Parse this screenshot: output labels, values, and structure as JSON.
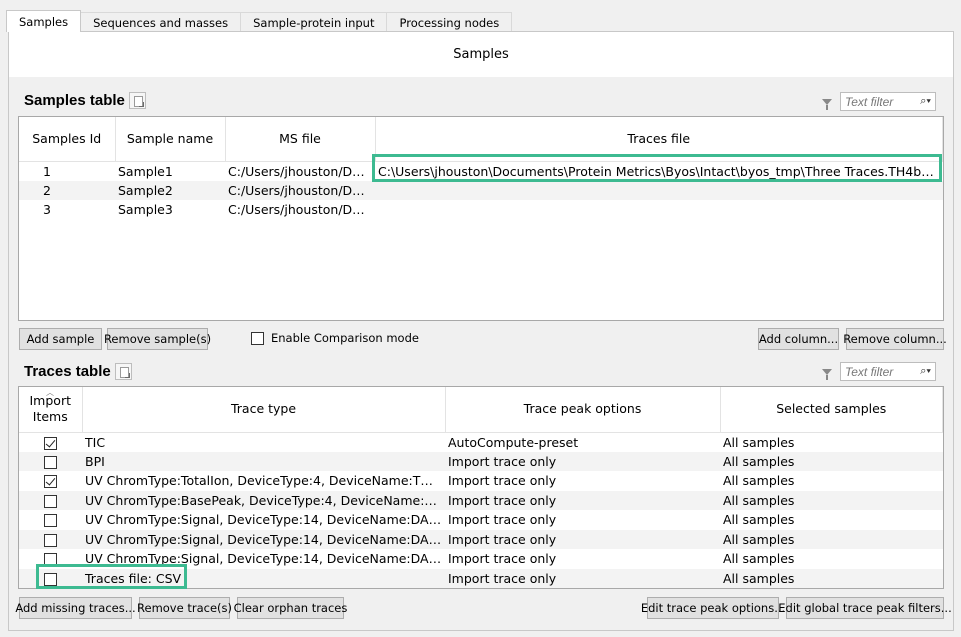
{
  "tabs": [
    "Samples",
    "Sequences and masses",
    "Sample-protein input",
    "Processing nodes"
  ],
  "header": "Samples",
  "samples_table": {
    "title": "Samples table",
    "filter_placeholder": "Text filter",
    "columns": [
      "Samples Id",
      "Sample name",
      "MS file",
      "Traces file"
    ],
    "rows": [
      [
        "1",
        "Sample1",
        "C:/Users/jhouston/Doc...",
        "C:\\Users\\jhouston\\Documents\\Protein Metrics\\Byos\\Intact\\byos_tmp\\Three Traces.TH4bW\\Thr..."
      ],
      [
        "2",
        "Sample2",
        "C:/Users/jhouston/Doc...",
        ""
      ],
      [
        "3",
        "Sample3",
        "C:/Users/jhouston/Doc...",
        ""
      ]
    ]
  },
  "samples_buttons": {
    "add_sample": "Add sample",
    "remove_samples": "Remove sample(s)",
    "enable_comparison": "Enable Comparison mode",
    "add_column": "Add column...",
    "remove_column": "Remove column..."
  },
  "traces_table": {
    "title": "Traces table",
    "filter_placeholder": "Text filter",
    "columns": [
      "Import Items",
      "Trace type",
      "Trace peak options",
      "Selected samples"
    ],
    "rows": [
      {
        "checked": true,
        "type": "TIC",
        "options": "AutoCompute-preset",
        "samples": "All samples"
      },
      {
        "checked": false,
        "type": "BPI",
        "options": "Import trace only",
        "samples": "All samples"
      },
      {
        "checked": true,
        "type": "UV ChromType:TotalIon, DeviceType:4, DeviceName:TOF, D...",
        "options": "Import trace only",
        "samples": "All samples"
      },
      {
        "checked": false,
        "type": "UV ChromType:BasePeak, DeviceType:4, DeviceName:TOF, ...",
        "options": "Import trace only",
        "samples": "All samples"
      },
      {
        "checked": false,
        "type": "UV ChromType:Signal, DeviceType:14, DeviceName:DAD, D...",
        "options": "Import trace only",
        "samples": "All samples"
      },
      {
        "checked": false,
        "type": "UV ChromType:Signal, DeviceType:14, DeviceName:DAD, D...",
        "options": "Import trace only",
        "samples": "All samples"
      },
      {
        "checked": false,
        "type": "UV ChromType:Signal, DeviceType:14, DeviceName:DAD, D...",
        "options": "Import trace only",
        "samples": "All samples"
      },
      {
        "checked": false,
        "type": "Traces file: CSV",
        "options": "Import trace only",
        "samples": "All samples"
      }
    ]
  },
  "traces_buttons": {
    "add_missing": "Add missing traces...",
    "remove_traces": "Remove trace(s)",
    "clear_orphan": "Clear orphan traces",
    "edit_peak_options": "Edit trace peak options...",
    "edit_global_filters": "Edit global trace peak filters..."
  },
  "colors": {
    "highlight": "#3dba91"
  }
}
